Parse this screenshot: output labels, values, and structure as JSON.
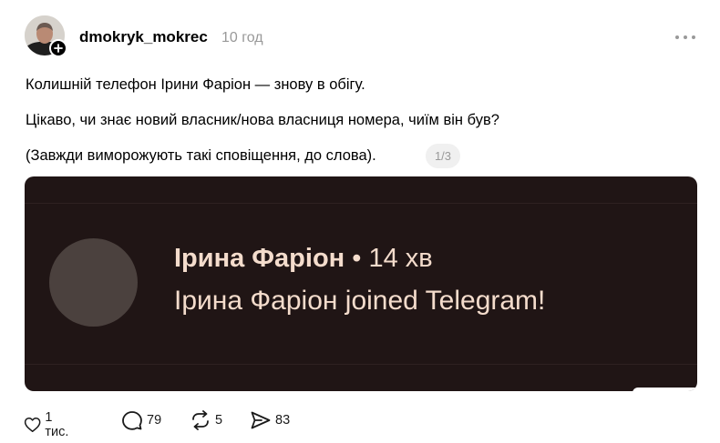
{
  "post": {
    "username": "dmokryk_mokrec",
    "timestamp": "10 год",
    "lines": [
      "Колишній телефон Ірини Фаріон — знову в обігу.",
      "Цікаво, чи знає новий власник/нова власниця номера, чиїм він був?",
      "(Завжди виморожують такі сповіщення, до слова)."
    ],
    "image_counter": "1/3"
  },
  "notification": {
    "name": "Ірина Фаріон",
    "separator": " • ",
    "time": "14 хв",
    "message": "Ірина Фаріон joined Telegram!"
  },
  "actions": {
    "likes": "1 тис.",
    "replies": "79",
    "reposts": "5",
    "shares": "83"
  },
  "colors": {
    "media_bg": "#201515",
    "notif_text": "#f4dccc",
    "muted": "#999999"
  }
}
